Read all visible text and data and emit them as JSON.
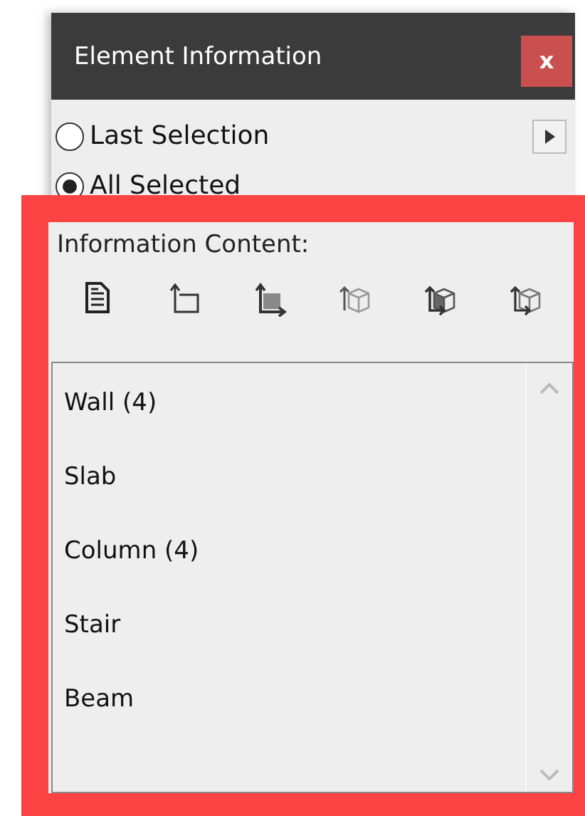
{
  "window": {
    "title": "Element Information",
    "close": "x"
  },
  "scope_options": [
    {
      "label": "Last Selection",
      "selected": false
    },
    {
      "label": "All Selected",
      "selected": true
    }
  ],
  "section_label": "Information Content:",
  "element_types": [
    {
      "label": "Wall (4)"
    },
    {
      "label": "Slab"
    },
    {
      "label": "Column (4)"
    },
    {
      "label": "Stair"
    },
    {
      "label": "Beam"
    }
  ]
}
